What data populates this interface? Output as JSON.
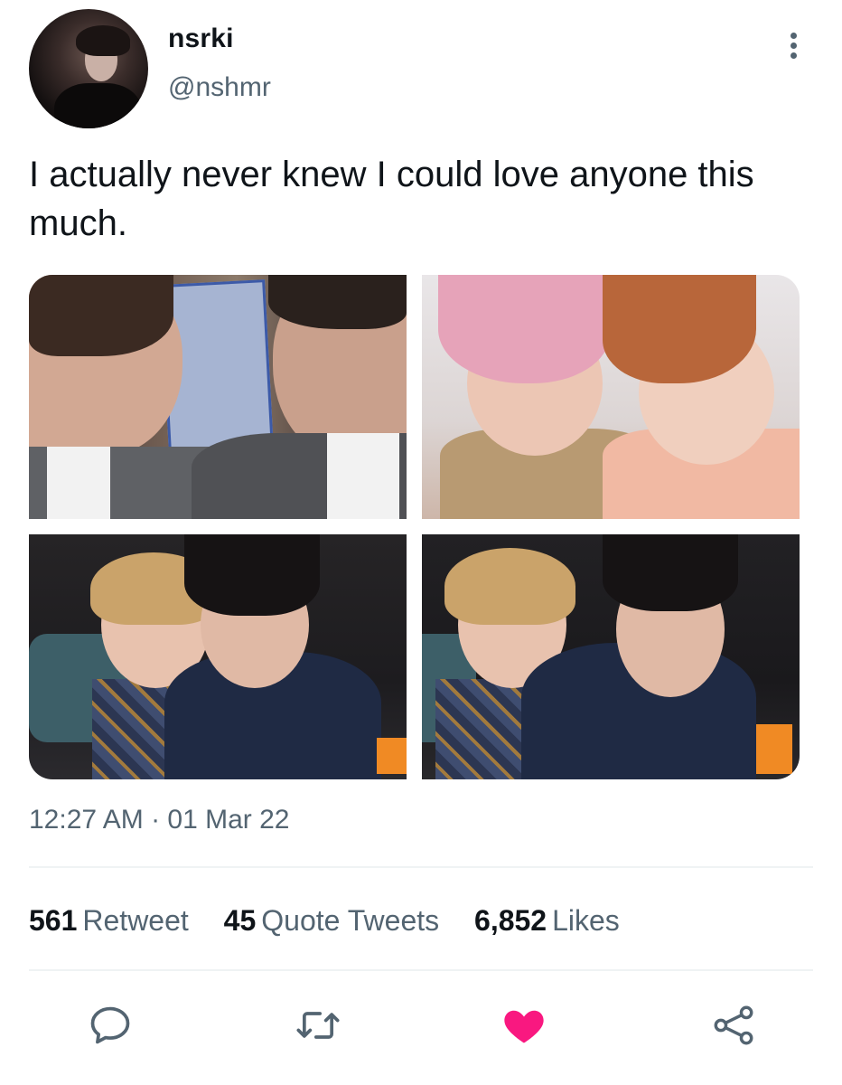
{
  "author": {
    "display_name": "nsrki",
    "handle": "@nshmr"
  },
  "tweet": {
    "text": "I actually never knew I could love anyone this much.",
    "timestamp": "12:27 AM · 01 Mar 22",
    "media_count": 4
  },
  "stats": {
    "retweets_count": "561",
    "retweets_label": "Retweet",
    "quotes_count": "45",
    "quotes_label": "Quote Tweets",
    "likes_count": "6,852",
    "likes_label": "Likes"
  },
  "actions": {
    "reply_icon": "speech-bubble-icon",
    "retweet_icon": "retweet-arrows-icon",
    "like_icon": "heart-icon",
    "share_icon": "share-nodes-icon",
    "liked": true
  },
  "colors": {
    "text_primary": "#0f1419",
    "text_secondary": "#536471",
    "like_active": "#f91880",
    "icon_default": "#536471",
    "divider": "#eff3f4"
  }
}
